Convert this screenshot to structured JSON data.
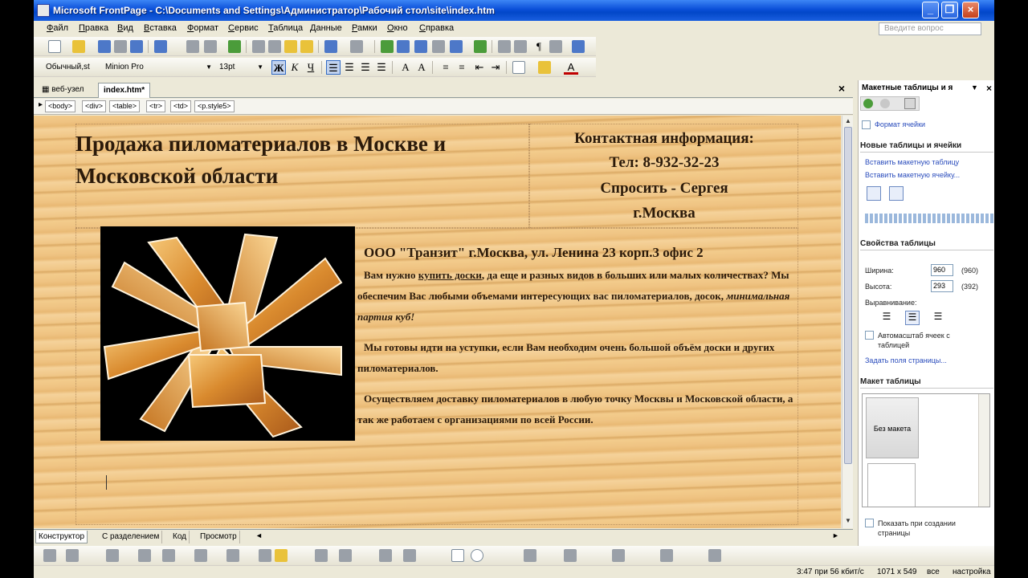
{
  "window": {
    "title": "Microsoft FrontPage - C:\\Documents and Settings\\Администратор\\Рабочий стол\\site\\index.htm"
  },
  "menu": {
    "items": [
      "Файл",
      "Правка",
      "Вид",
      "Вставка",
      "Формат",
      "Сервис",
      "Таблица",
      "Данные",
      "Рамки",
      "Окно",
      "Справка"
    ],
    "help_placeholder": "Введите вопрос"
  },
  "format_toolbar": {
    "style": "Обычный,st",
    "font": "Minion Pro",
    "size": "13pt",
    "bold": "Ж",
    "italic": "К",
    "underline": "Ч"
  },
  "document_tabs": [
    "веб-узел",
    "index.htm*"
  ],
  "tag_path": [
    "<body>",
    "<div>",
    "<table>",
    "<tr>",
    "<td>",
    "<p.style5>"
  ],
  "page": {
    "heading": "Продажа пиломатериалов в Москве и Московской области",
    "contact": {
      "title": "Контактная информация:",
      "phone": "Тел: 8-932-32-23",
      "ask": "Спросить - Сергея",
      "city": "г.Москва"
    },
    "company": "ООО \"Транзит\" г.Москва, ул. Ленина 23 корп.3 офис 2",
    "para1_a": "Вам нужно ",
    "para1_link": "купить доски",
    "para1_b": ", да еще и разных видов в больших или малых количествах? Мы обеспечим Вас  любыми объемами интересующих вас пиломатериалов, досок, ",
    "para1_italic": "минимальная партия куб!",
    "para2": "Мы готовы идти на уступки, если Вам необходим очень большой объём доски и других пиломатериалов.",
    "para3": "Осуществляем доставку пиломатериалов в любую точку Москвы и Московской области, а так же работаем с организациями по всей России."
  },
  "view_tabs": [
    "Конструктор",
    "С разделением",
    "Код",
    "Просмотр"
  ],
  "task_pane": {
    "title": "Макетные таблицы и я",
    "cell_format_link": "Формат ячейки",
    "new_section": "Новые таблицы и ячейки",
    "insert_table": "Вставить макетную таблицу",
    "insert_cell": "Вставить макетную ячейку...",
    "props_section": "Свойства таблицы",
    "width_label": "Ширина:",
    "width_value": "960",
    "width_actual": "(960)",
    "height_label": "Высота:",
    "height_value": "293",
    "height_actual": "(392)",
    "align_label": "Выравнивание:",
    "autoscale_label": "Автомасштаб ячеек с таблицей",
    "margins_link": "Задать поля страницы...",
    "layout_section": "Макет таблицы",
    "no_layout": "Без макета",
    "show_on_create": "Показать при создании страницы"
  },
  "status": {
    "time": "3:47 при 56 кбит/с",
    "size": "1071 x 549",
    "mode": "все",
    "settings": "настройка"
  }
}
